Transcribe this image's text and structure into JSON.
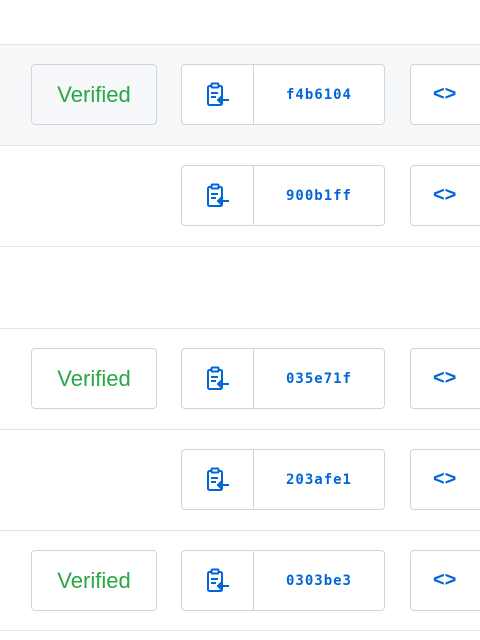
{
  "colors": {
    "verified": "#28a745",
    "link": "#0366d6",
    "border": "#d1d5da",
    "highlight": "#f6f8fa"
  },
  "commits": [
    {
      "verified_label": "Verified",
      "sha": "f4b6104",
      "browse_label": "<>",
      "copy_icon": "clipboard-icon"
    },
    {
      "verified_label": "",
      "sha": "900b1ff",
      "browse_label": "<>",
      "copy_icon": "clipboard-icon"
    },
    {
      "verified_label": "Verified",
      "sha": "035e71f",
      "browse_label": "<>",
      "copy_icon": "clipboard-icon"
    },
    {
      "verified_label": "",
      "sha": "203afe1",
      "browse_label": "<>",
      "copy_icon": "clipboard-icon"
    },
    {
      "verified_label": "Verified",
      "sha": "0303be3",
      "browse_label": "<>",
      "copy_icon": "clipboard-icon"
    }
  ]
}
